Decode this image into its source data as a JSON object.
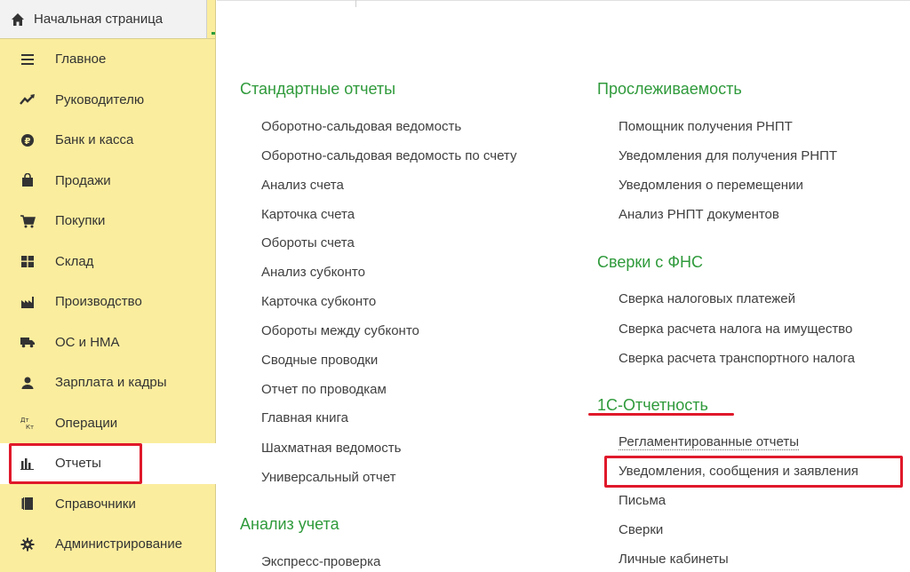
{
  "sidebar": {
    "home_label": "Начальная страница",
    "items": [
      {
        "label": "Главное",
        "icon": "menu-lines-icon"
      },
      {
        "label": "Руководителю",
        "icon": "trend-up-icon"
      },
      {
        "label": "Банк и касса",
        "icon": "ruble-coin-icon"
      },
      {
        "label": "Продажи",
        "icon": "shopping-bag-icon"
      },
      {
        "label": "Покупки",
        "icon": "cart-icon"
      },
      {
        "label": "Склад",
        "icon": "warehouse-icon"
      },
      {
        "label": "Производство",
        "icon": "factory-icon"
      },
      {
        "label": "ОС и НМА",
        "icon": "truck-icon"
      },
      {
        "label": "Зарплата и кадры",
        "icon": "person-icon"
      },
      {
        "label": "Операции",
        "icon": "debit-credit-icon"
      },
      {
        "label": "Отчеты",
        "icon": "bar-chart-icon",
        "active": true
      },
      {
        "label": "Справочники",
        "icon": "book-icon"
      },
      {
        "label": "Администрирование",
        "icon": "gear-icon"
      }
    ]
  },
  "left_column": {
    "sections": [
      {
        "title": "Стандартные отчеты",
        "links": [
          "Оборотно-сальдовая ведомость",
          "Оборотно-сальдовая ведомость по счету",
          "Анализ счета",
          "Карточка счета",
          "Обороты счета",
          "Анализ субконто",
          "Карточка субконто",
          "Обороты между субконто",
          "Сводные проводки",
          "Отчет по проводкам",
          "Главная книга",
          "Шахматная ведомость",
          "Универсальный отчет"
        ]
      },
      {
        "title": "Анализ учета",
        "links": [
          "Экспресс-проверка"
        ]
      }
    ]
  },
  "right_column": {
    "sections": [
      {
        "title": "Прослеживаемость",
        "links": [
          "Помощник получения РНПТ",
          "Уведомления для получения РНПТ",
          "Уведомления о перемещении",
          "Анализ РНПТ документов"
        ]
      },
      {
        "title": "Сверки с ФНС",
        "links": [
          "Сверка налоговых платежей",
          "Сверка расчета налога на имущество",
          "Сверка расчета транспортного налога"
        ]
      },
      {
        "title": "1С-Отчетность",
        "links": [
          "Регламентированные отчеты",
          "Уведомления, сообщения и заявления",
          "Письма",
          "Сверки",
          "Личные кабинеты"
        ]
      }
    ]
  },
  "colors": {
    "sidebar_bg": "#fbed9e",
    "section_title": "#2f9a3b",
    "highlight": "#e0192b"
  }
}
